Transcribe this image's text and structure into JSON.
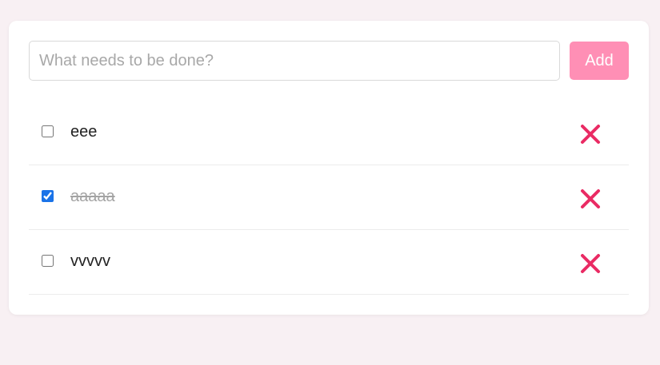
{
  "input": {
    "placeholder": "What needs to be done?",
    "value": ""
  },
  "add_button": {
    "label": "Add"
  },
  "colors": {
    "background": "#f8f0f3",
    "accent": "#ff8fb5",
    "delete": "#ea2b64",
    "checkbox_checked": "#1a73e8"
  },
  "todos": [
    {
      "text": "eee",
      "completed": false,
      "delete_icon": "close-icon"
    },
    {
      "text": "aaaaa",
      "completed": true,
      "delete_icon": "close-icon"
    },
    {
      "text": "vvvvv",
      "completed": false,
      "delete_icon": "close-icon"
    }
  ]
}
